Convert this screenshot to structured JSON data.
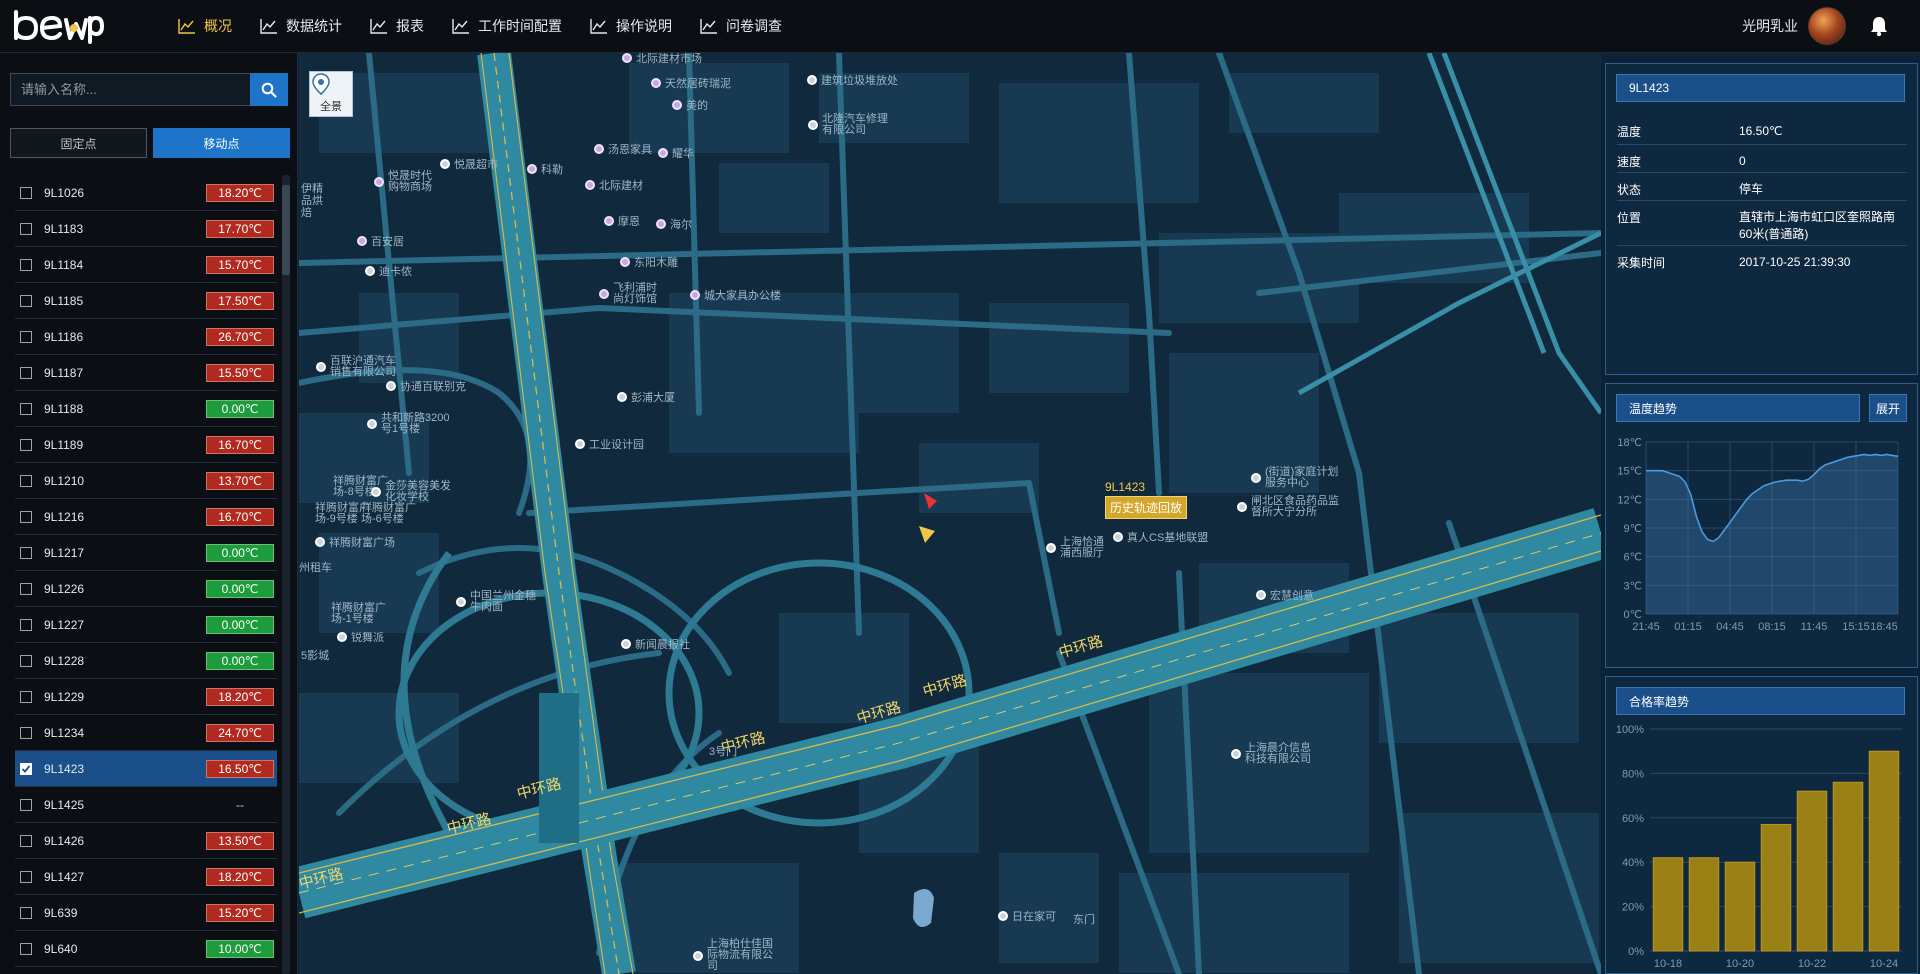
{
  "nav": {
    "items": [
      {
        "label": "概况",
        "active": true
      },
      {
        "label": "数据统计"
      },
      {
        "label": "报表"
      },
      {
        "label": "工作时间配置"
      },
      {
        "label": "操作说明"
      },
      {
        "label": "问卷调查"
      }
    ],
    "company": "光明乳业"
  },
  "sidebar": {
    "search_placeholder": "请输入名称...",
    "tabs": [
      {
        "label": "固定点"
      },
      {
        "label": "移动点",
        "active": true
      }
    ],
    "devices": [
      {
        "name": "9L1026",
        "temp": "18.20℃",
        "status": "hot"
      },
      {
        "name": "9L1183",
        "temp": "17.70℃",
        "status": "hot"
      },
      {
        "name": "9L1184",
        "temp": "15.70℃",
        "status": "hot"
      },
      {
        "name": "9L1185",
        "temp": "17.50℃",
        "status": "hot"
      },
      {
        "name": "9L1186",
        "temp": "26.70℃",
        "status": "hot"
      },
      {
        "name": "9L1187",
        "temp": "15.50℃",
        "status": "hot"
      },
      {
        "name": "9L1188",
        "temp": "0.00℃",
        "status": "ok"
      },
      {
        "name": "9L1189",
        "temp": "16.70℃",
        "status": "hot"
      },
      {
        "name": "9L1210",
        "temp": "13.70℃",
        "status": "hot"
      },
      {
        "name": "9L1216",
        "temp": "16.70℃",
        "status": "hot"
      },
      {
        "name": "9L1217",
        "temp": "0.00℃",
        "status": "ok"
      },
      {
        "name": "9L1226",
        "temp": "0.00℃",
        "status": "ok"
      },
      {
        "name": "9L1227",
        "temp": "0.00℃",
        "status": "ok"
      },
      {
        "name": "9L1228",
        "temp": "0.00℃",
        "status": "ok"
      },
      {
        "name": "9L1229",
        "temp": "18.20℃",
        "status": "hot"
      },
      {
        "name": "9L1234",
        "temp": "24.70℃",
        "status": "hot"
      },
      {
        "name": "9L1423",
        "temp": "16.50℃",
        "status": "hot",
        "checked": true
      },
      {
        "name": "9L1425",
        "temp": "--",
        "status": "none"
      },
      {
        "name": "9L1426",
        "temp": "13.50℃",
        "status": "hot"
      },
      {
        "name": "9L1427",
        "temp": "18.20℃",
        "status": "hot"
      },
      {
        "name": "9L639",
        "temp": "15.20℃",
        "status": "hot"
      },
      {
        "name": "9L640",
        "temp": "10.00℃",
        "status": "ok"
      }
    ]
  },
  "map": {
    "quanjing_label": "全景",
    "vehicle_label": "9L1423",
    "history_button": "历史轨迹回放",
    "roads": [
      "中环路",
      "中环路",
      "中环路",
      "中环路",
      "中环路",
      "中环路",
      "中环路"
    ],
    "pois": [
      {
        "label": "北际建材市场",
        "type": "p"
      },
      {
        "label": "天然居砖瑞泥",
        "type": "p"
      },
      {
        "label": "美的",
        "type": "p"
      },
      {
        "label": "建筑垃圾堆放处",
        "type": "g"
      },
      {
        "label": "北隆汽车修理有限公司",
        "type": "g"
      },
      {
        "label": "悦晟超市",
        "type": "g"
      },
      {
        "label": "悦晟时代购物商场",
        "type": "p"
      },
      {
        "label": "科勒",
        "type": "p"
      },
      {
        "label": "汤恩家具",
        "type": "p"
      },
      {
        "label": "耀华",
        "type": "p"
      },
      {
        "label": "北际建材",
        "type": "p"
      },
      {
        "label": "摩恩",
        "type": "p"
      },
      {
        "label": "海尔",
        "type": "p"
      },
      {
        "label": "东阳木雕",
        "type": "p"
      },
      {
        "label": "飞利浦时尚灯饰馆",
        "type": "p"
      },
      {
        "label": "城大家具办公楼",
        "type": "p"
      },
      {
        "label": "伊精品烘焙",
        "type": "g"
      },
      {
        "label": "百安居",
        "type": "p"
      },
      {
        "label": "迪卡侬",
        "type": "g"
      },
      {
        "label": "百联沪通汽车销售有限公司",
        "type": "g"
      },
      {
        "label": "协通百联别克",
        "type": "g"
      },
      {
        "label": "彭浦大厦",
        "type": "g"
      },
      {
        "label": "共和新路3200号1号楼",
        "type": "g"
      },
      {
        "label": "工业设计园",
        "type": "g"
      },
      {
        "label": "祥腾财富广场-8号楼",
        "type": "g"
      },
      {
        "label": "金莎美容美发化妆学校",
        "type": "g"
      },
      {
        "label": "祥腾财富广场-9号楼",
        "type": "g"
      },
      {
        "label": "祥腾财富广场-6号楼",
        "type": "g"
      },
      {
        "label": "祥腾财富广场",
        "type": "g"
      },
      {
        "label": "州租车",
        "type": "g"
      },
      {
        "label": "中国兰州金穗牛肉面",
        "type": "g"
      },
      {
        "label": "祥腾财富广场-1号楼",
        "type": "g"
      },
      {
        "label": "锐舞派",
        "type": "g"
      },
      {
        "label": "5影城",
        "type": "g"
      },
      {
        "label": "新闻晨报社",
        "type": "g"
      },
      {
        "label": "上海恰通浦西服厅",
        "type": "g"
      },
      {
        "label": "真人CS基地联盟",
        "type": "g"
      },
      {
        "label": "(街道)家庭计划服务中心",
        "type": "g"
      },
      {
        "label": "闸北区食品药品监督所大宁分所",
        "type": "g"
      },
      {
        "label": "宏慧创意",
        "type": "g"
      },
      {
        "label": "上海晨介信息科技有限公司",
        "type": "g"
      },
      {
        "label": "日在家可",
        "type": "g"
      },
      {
        "label": "东门",
        "type": "g"
      },
      {
        "label": "3号门",
        "type": "g"
      },
      {
        "label": "上海柏仕佳国际物流有限公司",
        "type": "g"
      }
    ]
  },
  "info": {
    "title": "9L1423",
    "rows": [
      {
        "k": "温度",
        "v": "16.50℃"
      },
      {
        "k": "速度",
        "v": "0"
      },
      {
        "k": "状态",
        "v": "停车"
      },
      {
        "k": "位置",
        "v": "直辖市上海市虹口区奎照路南60米(普通路)"
      },
      {
        "k": "采集时间",
        "v": "2017-10-25 21:39:30"
      }
    ]
  },
  "temp_trend": {
    "title": "温度趋势",
    "expand": "展开",
    "chart_data": {
      "type": "area",
      "y_ticks": [
        "18℃",
        "15℃",
        "12℃",
        "9℃",
        "6℃",
        "3℃",
        "0℃"
      ],
      "x_ticks": [
        "21:45",
        "01:15",
        "04:45",
        "08:15",
        "11:45",
        "15:15",
        "18:45"
      ],
      "ylim": [
        0,
        18
      ],
      "values": [
        15.0,
        15.0,
        15.0,
        15.0,
        14.8,
        14.6,
        14.4,
        13.8,
        12.5,
        10.2,
        8.6,
        7.8,
        7.6,
        8.0,
        8.8,
        9.6,
        10.4,
        11.2,
        12.0,
        12.6,
        13.0,
        13.4,
        13.6,
        13.8,
        13.9,
        14.0,
        14.0,
        14.0,
        13.9,
        14.1,
        14.6,
        15.2,
        15.6,
        15.8,
        16.0,
        16.2,
        16.4,
        16.5,
        16.6,
        16.7,
        16.6,
        16.7,
        16.6,
        16.7,
        16.6,
        16.5
      ]
    }
  },
  "pass_rate": {
    "title": "合格率趋势",
    "chart_data": {
      "type": "bar",
      "categories": [
        "10-18",
        "",
        "10-20",
        "",
        "10-22",
        "",
        "10-24"
      ],
      "values": [
        42,
        42,
        40,
        57,
        72,
        76,
        90
      ],
      "y_ticks": [
        "100%",
        "80%",
        "60%",
        "40%",
        "20%",
        "0%"
      ],
      "ylim": [
        0,
        100
      ]
    }
  }
}
